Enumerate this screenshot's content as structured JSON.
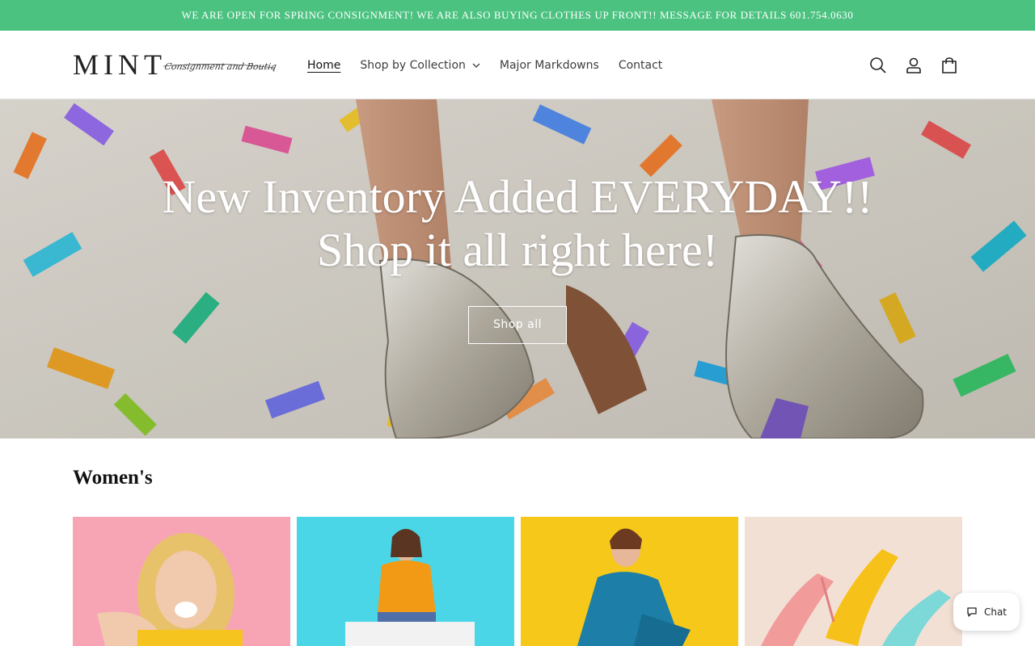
{
  "announcement": {
    "text": "WE ARE OPEN FOR SPRING CONSIGNMENT! WE ARE ALSO BUYING CLOTHES UP FRONT!! MESSAGE FOR DETAILS 601.754.0630",
    "background": "#4cc281"
  },
  "header": {
    "logo": {
      "main": "MINT",
      "script": "Consignment and Boutique"
    },
    "nav": [
      {
        "label": "Home",
        "active": true
      },
      {
        "label": "Shop by Collection",
        "has_dropdown": true
      },
      {
        "label": "Major Markdowns"
      },
      {
        "label": "Contact"
      }
    ],
    "icons": [
      "search-icon",
      "account-icon",
      "cart-icon"
    ]
  },
  "hero": {
    "title_line1": "New Inventory Added EVERYDAY!!",
    "title_line2": "Shop it all right here!",
    "button_label": "Shop all"
  },
  "collection": {
    "title": "Women's",
    "cards": [
      {
        "name": "card-woman-yellow",
        "color": "#f7a5b4"
      },
      {
        "name": "card-woman-orange",
        "color": "#4ad6e6"
      },
      {
        "name": "card-woman-blue",
        "color": "#f6c81a"
      },
      {
        "name": "card-heels",
        "color": "#f3e0d4"
      }
    ]
  },
  "chat": {
    "label": "Chat"
  }
}
